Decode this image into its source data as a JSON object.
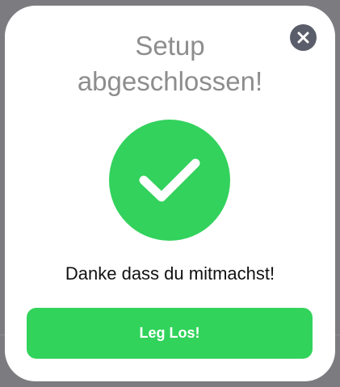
{
  "dialog": {
    "title_line1": "Setup",
    "title_line2": "abgeschlossen!",
    "message": "Danke dass du mitmachst!",
    "cta_label": "Leg Los!",
    "close_icon": "close-icon",
    "success_icon": "checkmark-icon"
  },
  "colors": {
    "accent_green": "#32d25c",
    "title_gray": "#8d8d8d",
    "close_button": "#5a5e6a",
    "backdrop": "#7c7c80"
  }
}
